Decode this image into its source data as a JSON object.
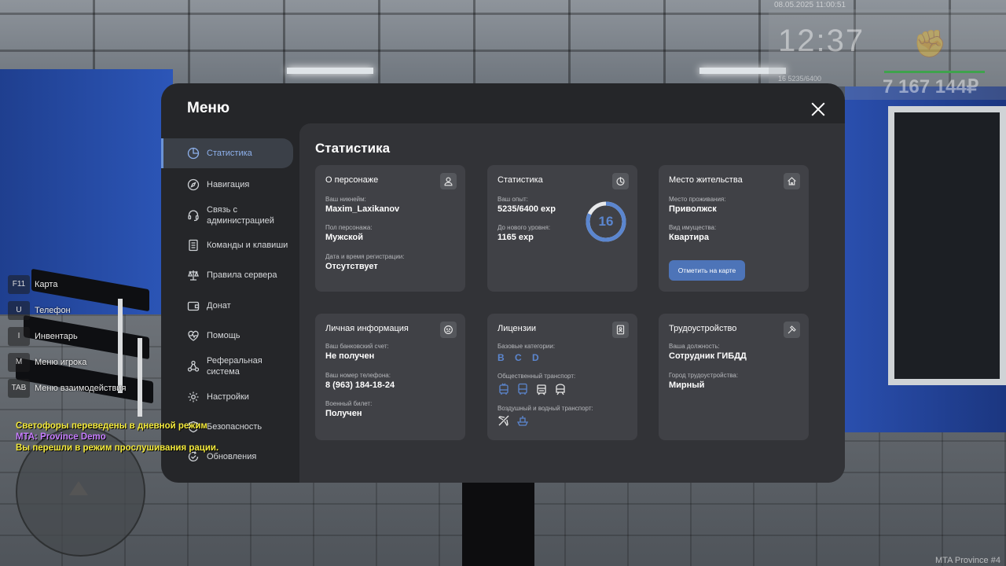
{
  "hud": {
    "datetime": "08.05.2025 11:00:51",
    "time": "12:37",
    "level_xp": "16   5235/6400",
    "money": "7 167 144₽"
  },
  "hotkeys": [
    {
      "key": "F11",
      "label": "Карта"
    },
    {
      "key": "U",
      "label": "Телефон"
    },
    {
      "key": "I",
      "label": "Инвентарь"
    },
    {
      "key": "M",
      "label": "Меню игрока"
    },
    {
      "key": "TAB",
      "label": "Меню взаимодействия"
    }
  ],
  "chat": [
    {
      "text": "Светофоры переведены в дневной режим",
      "color": "#f4ea3c"
    },
    {
      "text": "MTA: Province Demo",
      "color": "#c77dff"
    },
    {
      "text": "Вы перешли в режим прослушивания рации.",
      "color": "#f4ea3c"
    }
  ],
  "watermark": "MTA Province #4",
  "menu": {
    "title": "Меню",
    "sidebar": [
      {
        "label": "Статистика",
        "icon": "pie-chart-icon",
        "active": true
      },
      {
        "label": "Навигация",
        "icon": "compass-icon",
        "active": false
      },
      {
        "label": "Связь с администрацией",
        "icon": "headset-icon",
        "active": false
      },
      {
        "label": "Команды и клавиши",
        "icon": "document-list-icon",
        "active": false
      },
      {
        "label": "Правила сервера",
        "icon": "scales-icon",
        "active": false
      },
      {
        "label": "Донат",
        "icon": "wallet-icon",
        "active": false
      },
      {
        "label": "Помощь",
        "icon": "heart-pulse-icon",
        "active": false
      },
      {
        "label": "Реферальная система",
        "icon": "network-icon",
        "active": false
      },
      {
        "label": "Настройки",
        "icon": "gear-icon",
        "active": false
      },
      {
        "label": "Безопасность",
        "icon": "shield-icon",
        "active": false
      },
      {
        "label": "Обновления",
        "icon": "refresh-check-icon",
        "active": false
      }
    ],
    "section_title": "Статистика",
    "cards": {
      "character": {
        "title": "О персонаже",
        "nickname_label": "Ваш никнейм:",
        "nickname": "Maxim_Laxikanov",
        "gender_label": "Пол персонажа:",
        "gender": "Мужской",
        "reg_label": "Дата и время регистрации:",
        "reg": "Отсутствует"
      },
      "stats": {
        "title": "Статистика",
        "exp_label": "Ваш опыт:",
        "exp": "5235/6400 exp",
        "next_label": "До нового уровня:",
        "next": "1165 exp",
        "level": "16",
        "progress": 0.818
      },
      "residence": {
        "title": "Место жительства",
        "place_label": "Место проживания:",
        "place": "Приволжск",
        "property_label": "Вид имущества:",
        "property": "Квартира",
        "map_button": "Отметить на карте"
      },
      "personal": {
        "title": "Личная информация",
        "bank_label": "Ваш банковский счет:",
        "bank": "Не получен",
        "phone_label": "Ваш номер телефона:",
        "phone": "8 (963) 184-18-24",
        "military_label": "Военный билет:",
        "military": "Получен"
      },
      "licenses": {
        "title": "Лицензии",
        "base_label": "Базовые категории:",
        "base": "B C D",
        "public_label": "Общественный транспорт:",
        "air_label": "Воздушный и водный транспорт:"
      },
      "employment": {
        "title": "Трудоустройство",
        "position_label": "Ваша должность:",
        "position": "Сотрудник ГИБДД",
        "city_label": "Город трудоустройства:",
        "city": "Мирный"
      }
    }
  }
}
